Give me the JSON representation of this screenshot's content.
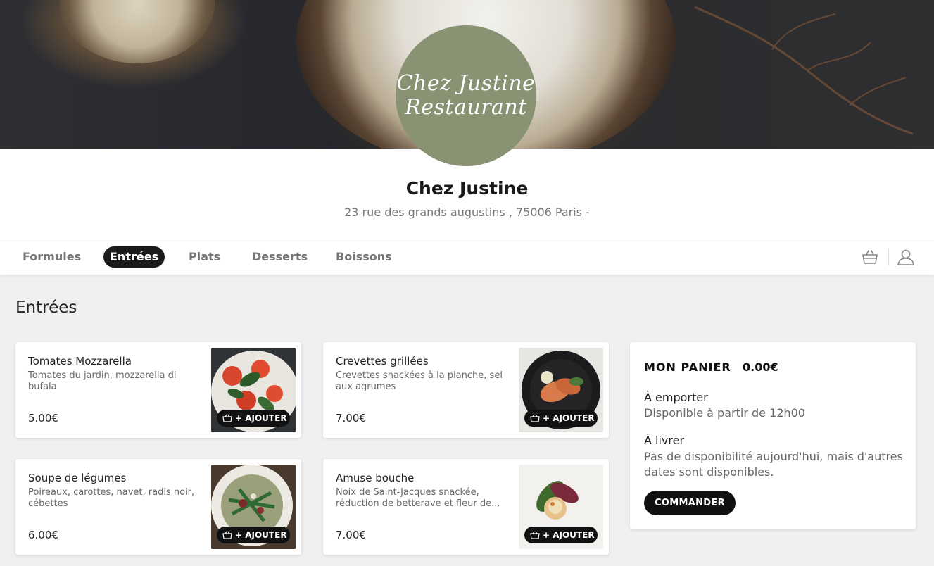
{
  "logo": {
    "line1": "Chez Justine",
    "line2": "Restaurant"
  },
  "restaurant": {
    "name": "Chez Justine",
    "address": "23 rue des grands augustins , 75006 Paris -"
  },
  "nav": {
    "tabs": [
      {
        "label": "Formules",
        "active": false
      },
      {
        "label": "Entrées",
        "active": true
      },
      {
        "label": "Plats",
        "active": false
      },
      {
        "label": "Desserts",
        "active": false
      },
      {
        "label": "Boissons",
        "active": false
      }
    ],
    "icons": [
      "basket-icon",
      "user-icon"
    ]
  },
  "section": {
    "title": "Entrées"
  },
  "items": [
    {
      "title": "Tomates Mozzarella",
      "description": "Tomates du jardin, mozzarella di bufala",
      "price": "5.00€",
      "add_label": "+ AJOUTER"
    },
    {
      "title": "Crevettes grillées",
      "description": "Crevettes snackées à la planche, sel aux agrumes",
      "price": "7.00€",
      "add_label": "+ AJOUTER"
    },
    {
      "title": "Soupe de légumes",
      "description": "Poireaux, carottes, navet, radis noir, cébettes",
      "price": "6.00€",
      "add_label": "+ AJOUTER"
    },
    {
      "title": "Amuse bouche",
      "description": "Noix de Saint-Jacques snackée, réduction de betterave et fleur de...",
      "price": "7.00€",
      "add_label": "+ AJOUTER"
    }
  ],
  "cart": {
    "heading": "MON PANIER",
    "total": "0.00€",
    "takeaway_title": "À emporter",
    "takeaway_text": "Disponible à partir de 12h00",
    "delivery_title": "À livrer",
    "delivery_text": "Pas de disponibilité aujourd'hui, mais d'autres dates sont disponibles.",
    "order_button": "COMMANDER"
  }
}
